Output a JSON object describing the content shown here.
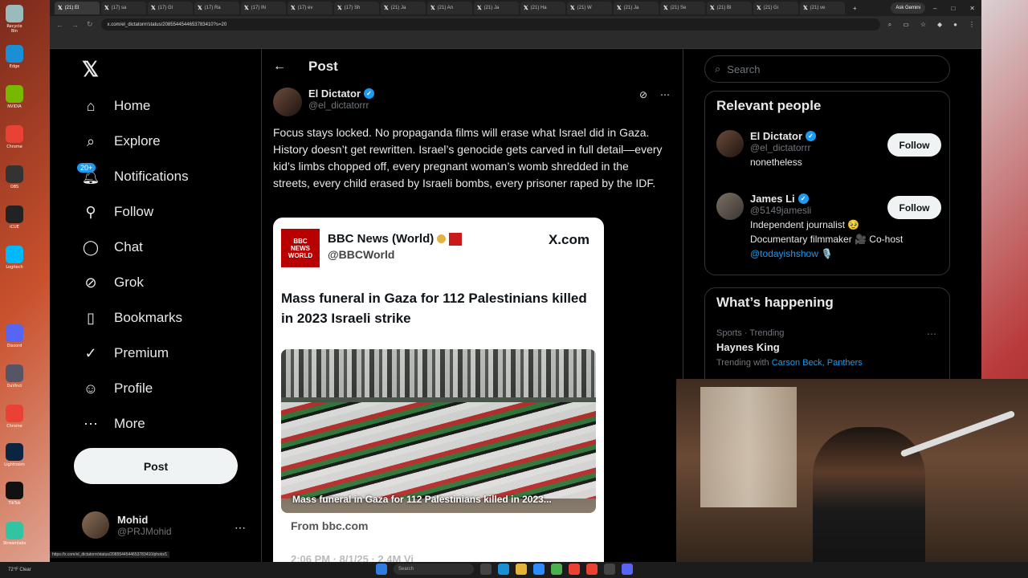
{
  "browser": {
    "tabs": [
      "(21) El",
      "(17) sa",
      "(17) Gl",
      "(17) Ra",
      "(17) IN",
      "(17) ev",
      "(17) Sh",
      "(21) Ja",
      "(21) An",
      "(21) Ja",
      "(21) Ha",
      "(21) W",
      "(21) Ja",
      "(21) Se",
      "(21) Bl",
      "(21) Gi",
      "(21) ve"
    ],
    "ask_gemini": "Ask Gemini",
    "url": "x.com/el_dictatorrr/status/2085544544653783410?s=20",
    "status_url": "https://x.com/el_dictatorrr/status/2085544544653783410/photo/1"
  },
  "nav": {
    "logo": "𝕏",
    "items": [
      {
        "label": "Home",
        "icon": "home-icon"
      },
      {
        "label": "Explore",
        "icon": "search-icon"
      },
      {
        "label": "Notifications",
        "icon": "bell-icon"
      },
      {
        "label": "Follow",
        "icon": "follow-icon"
      },
      {
        "label": "Chat",
        "icon": "chat-icon"
      },
      {
        "label": "Grok",
        "icon": "grok-icon"
      },
      {
        "label": "Bookmarks",
        "icon": "bookmark-icon"
      },
      {
        "label": "Premium",
        "icon": "premium-icon"
      },
      {
        "label": "Profile",
        "icon": "profile-icon"
      },
      {
        "label": "More",
        "icon": "more-icon"
      }
    ],
    "notif_badge": "20+",
    "post_button": "Post",
    "account": {
      "name": "Mohid",
      "handle": "@PRJMohid"
    }
  },
  "post": {
    "header_title": "Post",
    "author_name": "El Dictator",
    "author_handle": "@el_dictatorrr",
    "text": "Focus stays locked. No propaganda films will erase what Israel did in Gaza. History doesn’t get rewritten. Israel’s genocide gets carved in full detail—every kid’s limbs chopped off, every pregnant woman’s womb shredded in the streets, every child erased by Israeli bombs, every prisoner raped by the IDF.",
    "card": {
      "source_name": "BBC News (World)",
      "source_handle": "@BBCWorld",
      "site": "X.com",
      "logo_text_1": "BBC",
      "logo_text_2": "NEWS",
      "logo_text_3": "WORLD",
      "headline": "Mass funeral in Gaza for 112 Palestinians killed in 2023 Israeli strike",
      "image_caption": "Mass funeral in Gaza for 112 Palestinians killed in 2023...",
      "from": "From bbc.com",
      "meta_partial": "2:06 PM · 8/1/25 · 2.4M Vi"
    }
  },
  "sidebar": {
    "search_placeholder": "Search",
    "relevant_title": "Relevant people",
    "people": [
      {
        "name": "El Dictator",
        "handle": "@el_dictatorrr",
        "bio": "nonetheless",
        "follow": "Follow"
      },
      {
        "name": "James Li",
        "handle": "@5149jamesli",
        "bio_1": "Independent journalist 🥹",
        "bio_2": "Documentary filmmaker 🎥 Co-host",
        "bio_link": "@todayishshow",
        "bio_emoji": "🎙️",
        "follow": "Follow"
      }
    ],
    "happening_title": "What’s happening",
    "trend": {
      "meta": "Sports · Trending",
      "name": "Haynes King",
      "with_label": "Trending with",
      "with_links": "Carson Beck, Panthers"
    }
  },
  "taskbar": {
    "weather": "72°F Clear",
    "search": "Search"
  }
}
